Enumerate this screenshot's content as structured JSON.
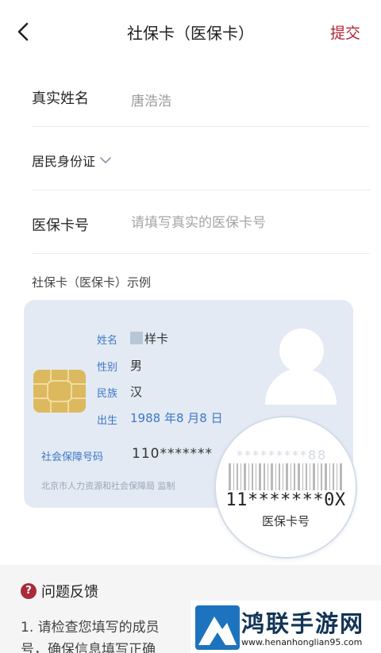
{
  "header": {
    "title": "社保卡（医保卡）",
    "submit_label": "提交"
  },
  "form": {
    "name_label": "真实姓名",
    "name_value": "唐浩浩",
    "id_type_label": "居民身份证",
    "card_label": "医保卡号",
    "card_placeholder": "请填写真实的医保卡号"
  },
  "example": {
    "title": "社保卡（医保卡）示例",
    "card": {
      "name_label": "姓名",
      "name_value": "样卡",
      "gender_label": "性别",
      "gender_value": "男",
      "ethnicity_label": "民族",
      "ethnicity_value": "汉",
      "birth_label": "出生",
      "birth_value": "1988 年8 月8 日",
      "ss_label": "社会保障号码",
      "ss_value": "110*******",
      "issuer": "北京市人力资源和社会保障局 监制"
    },
    "magnifier": {
      "faint_number": "*********88",
      "number": "11*******0X",
      "caption": "医保卡号"
    }
  },
  "feedback": {
    "icon": "?",
    "title": "问题反馈",
    "line1": "1. 请检查您填写的成员",
    "line2": "号，确保信息填写正确"
  },
  "watermark": {
    "title": "鸿联手游网",
    "url": "www.henanhonglian95.com"
  },
  "colors": {
    "accent": "#b3243a",
    "card_background": "#e3eaf4",
    "card_label": "#3c78c4",
    "chip": "#dcb95f"
  },
  "icons": {
    "back": "chevron-left-icon",
    "dropdown": "chevron-down-icon",
    "feedback": "question-circle-icon"
  }
}
